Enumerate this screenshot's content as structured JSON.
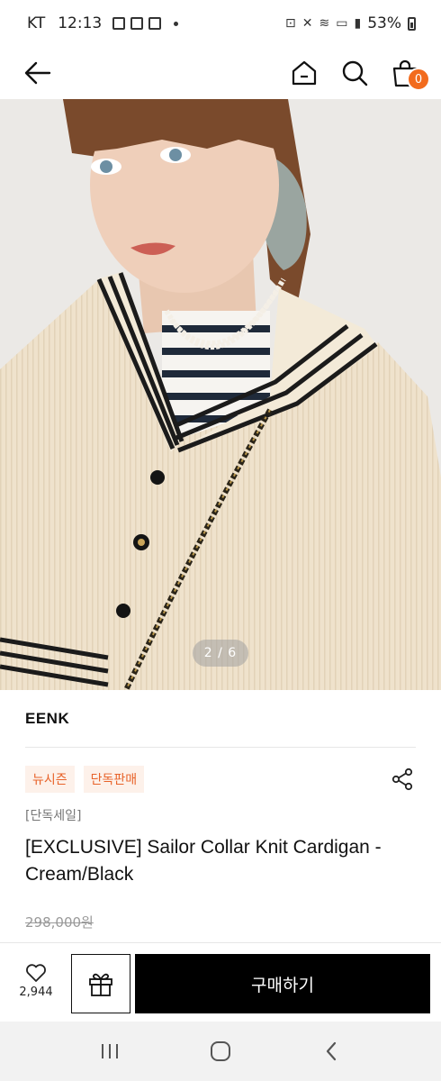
{
  "status_bar": {
    "carrier": "KT",
    "time": "12:13",
    "battery": "53%"
  },
  "header": {
    "cart_count": "0"
  },
  "gallery": {
    "current": "2",
    "total": "6",
    "counter_text": "2 / 6"
  },
  "product": {
    "brand": "EENK",
    "tags": [
      "뉴시즌",
      "단독판매"
    ],
    "sale_label": "[단독세일]",
    "title": "[EXCLUSIVE] Sailor Collar Knit Cardigan - Cream/Black",
    "original_price": "298,000원"
  },
  "actions": {
    "like_count": "2,944",
    "buy_label": "구매하기"
  },
  "colors": {
    "accent": "#f26b1d",
    "tag_text": "#e8632a",
    "tag_bg": "#fdf1ea",
    "buy_button": "#000000"
  }
}
